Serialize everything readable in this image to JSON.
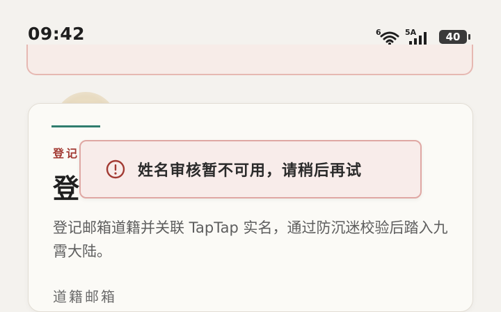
{
  "status_bar": {
    "time": "09:42",
    "wifi_label": "6",
    "network_label": "5A",
    "battery_level": "40"
  },
  "card": {
    "eyebrow": "登记",
    "title": "登",
    "description": "登记邮箱道籍并关联 TapTap 实名，通过防沉迷校验后踏入九霄大陆。",
    "field_label": "道籍邮箱"
  },
  "toast": {
    "icon": "alert-circle-icon",
    "message": "姓名审核暂不可用，请稍后再试"
  },
  "colors": {
    "accent_teal": "#2f7d6e",
    "accent_red": "#a23a33",
    "toast_border": "#dfa7a3"
  }
}
